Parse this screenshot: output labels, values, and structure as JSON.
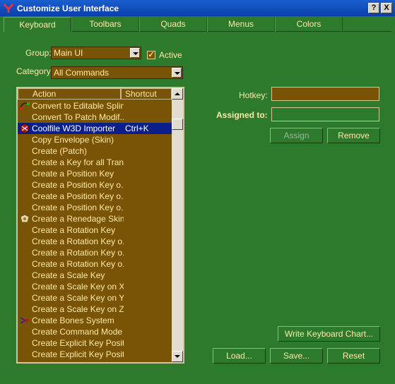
{
  "window": {
    "title": "Customize User Interface",
    "help_label": "?",
    "close_label": "X"
  },
  "tabs": [
    {
      "label": "Keyboard"
    },
    {
      "label": "Toolbars"
    },
    {
      "label": "Quads"
    },
    {
      "label": "Menus"
    },
    {
      "label": "Colors"
    }
  ],
  "group": {
    "label": "Group:",
    "value": "Main UI",
    "active_label": "Active",
    "active_checked": true
  },
  "category": {
    "label": "Category:",
    "value": "All Commands"
  },
  "list": {
    "columns": {
      "action": "Action",
      "shortcut": "Shortcut"
    },
    "rows": [
      {
        "icon": "editable-spline-icon",
        "name": "Convert to Editable Spline",
        "shortcut": ""
      },
      {
        "icon": "",
        "name": "Convert To Patch Modif...",
        "shortcut": ""
      },
      {
        "icon": "coolfile-importer-icon",
        "name": "Coolfile W3D Importer",
        "shortcut": "Ctrl+K",
        "selected": true
      },
      {
        "icon": "",
        "name": "Copy Envelope (Skin)",
        "shortcut": ""
      },
      {
        "icon": "",
        "name": "Create (Patch)",
        "shortcut": ""
      },
      {
        "icon": "",
        "name": "Create a Key for all Tran...",
        "shortcut": ""
      },
      {
        "icon": "",
        "name": "Create a Position Key",
        "shortcut": ""
      },
      {
        "icon": "",
        "name": "Create a Position Key o...",
        "shortcut": ""
      },
      {
        "icon": "",
        "name": "Create a Position Key o...",
        "shortcut": ""
      },
      {
        "icon": "",
        "name": "Create a Position Key o...",
        "shortcut": ""
      },
      {
        "icon": "renegade-skin-icon",
        "name": "Create a Renedage Skin",
        "shortcut": ""
      },
      {
        "icon": "",
        "name": "Create a Rotation Key",
        "shortcut": ""
      },
      {
        "icon": "",
        "name": "Create a Rotation Key o...",
        "shortcut": ""
      },
      {
        "icon": "",
        "name": "Create a Rotation Key o...",
        "shortcut": ""
      },
      {
        "icon": "",
        "name": "Create a Rotation Key o...",
        "shortcut": ""
      },
      {
        "icon": "",
        "name": "Create a Scale Key",
        "shortcut": ""
      },
      {
        "icon": "",
        "name": "Create a Scale Key on X",
        "shortcut": ""
      },
      {
        "icon": "",
        "name": "Create a Scale Key on Y",
        "shortcut": ""
      },
      {
        "icon": "",
        "name": "Create a Scale Key on Z",
        "shortcut": ""
      },
      {
        "icon": "bones-icon",
        "name": "Create Bones System",
        "shortcut": ""
      },
      {
        "icon": "",
        "name": "Create Command Mode",
        "shortcut": ""
      },
      {
        "icon": "",
        "name": "Create Explicit Key Posit...",
        "shortcut": ""
      },
      {
        "icon": "",
        "name": "Create Explicit Key Posit...",
        "shortcut": ""
      }
    ]
  },
  "hotkey": {
    "label": "Hotkey:",
    "value": ""
  },
  "assigned_to": {
    "label": "Assigned to:",
    "value": ""
  },
  "buttons": {
    "assign": "Assign",
    "remove": "Remove",
    "write_chart": "Write Keyboard Chart...",
    "load": "Load...",
    "save": "Save...",
    "reset": "Reset"
  },
  "colors": {
    "background": "#2d7a2d",
    "list_bg": "#7a5406",
    "text": "#ffe9a8",
    "selection": "#0a1f8a",
    "titlebar": "#0a3fa8"
  }
}
